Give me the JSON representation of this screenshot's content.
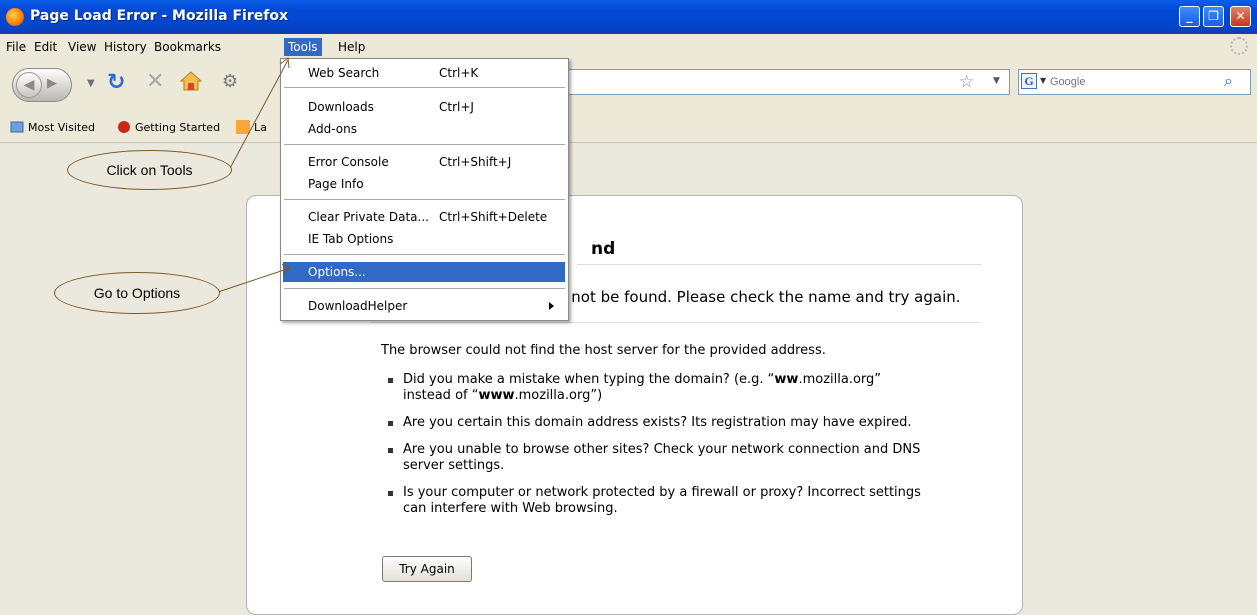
{
  "window": {
    "title": "Page Load Error - Mozilla Firefox",
    "icon": "firefox-icon",
    "minimize": "_",
    "restore": "❐",
    "close": "✕"
  },
  "menubar": {
    "items": [
      "File",
      "Edit",
      "View",
      "History",
      "Bookmarks",
      "Tools",
      "Help"
    ],
    "active": "Tools"
  },
  "navbar": {
    "search_placeholder": "Google"
  },
  "bookmarks": {
    "items": [
      "Most Visited",
      "Getting Started",
      "La"
    ]
  },
  "tools_menu": {
    "items": [
      {
        "label": "Web Search",
        "shortcut": "Ctrl+K"
      },
      {
        "label": "Downloads",
        "shortcut": "Ctrl+J"
      },
      {
        "label": "Add-ons",
        "shortcut": ""
      },
      {
        "label": "Error Console",
        "shortcut": "Ctrl+Shift+J"
      },
      {
        "label": "Page Info",
        "shortcut": ""
      },
      {
        "label": "Clear Private Data...",
        "shortcut": "Ctrl+Shift+Delete"
      },
      {
        "label": "IE Tab Options",
        "shortcut": ""
      },
      {
        "label": "Options...",
        "shortcut": "",
        "selected": true
      },
      {
        "label": "DownloadHelper",
        "shortcut": "",
        "submenu": true
      }
    ]
  },
  "error_page": {
    "title_visible": "nd",
    "short_desc_visible": "d not be found. Please check the name and try again.",
    "long_desc": "The browser could not find the host server for the provided address.",
    "bullets": [
      [
        "Did you make a mistake when typing the domain? (e.g. “",
        "ww",
        ".mozilla.org”",
        "instead of “",
        "www",
        ".mozilla.org”)"
      ],
      "Are you certain this domain address exists? Its registration may have expired.",
      "Are you unable to browse other sites? Check your network connection and DNS server settings.",
      "Is your computer or network protected by a firewall or proxy? Incorrect settings can interfere with Web browsing."
    ],
    "try_again": "Try Again"
  },
  "annotations": {
    "click_tools": "Click on Tools",
    "go_to_options": "Go to Options"
  },
  "colors": {
    "titlebar": "#0449d6",
    "menu_highlight": "#316ac5",
    "chrome": "#ece9d8",
    "callout_border": "#7a5a2a"
  }
}
